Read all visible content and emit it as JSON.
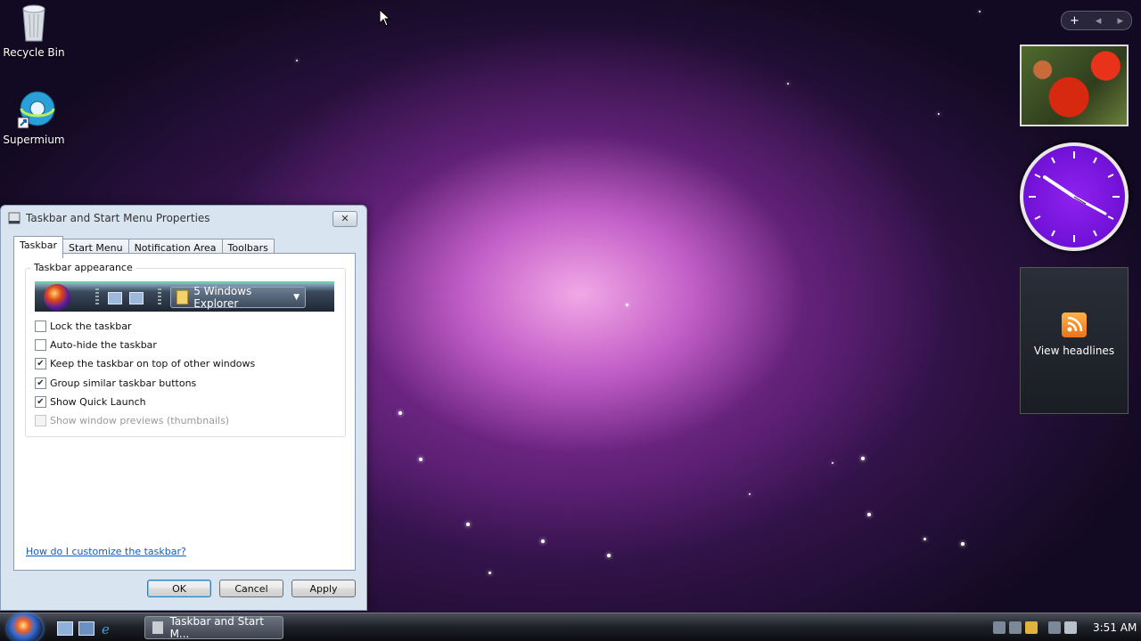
{
  "desktop": {
    "icons": [
      {
        "label": "Recycle Bin",
        "icon": "recycle-bin-icon"
      },
      {
        "label": "Supermium",
        "icon": "browser-globe-icon"
      }
    ]
  },
  "sidebar": {
    "controls": [
      "+",
      "◂",
      "▸"
    ],
    "feed_label": "View headlines",
    "clock_time": "3:51"
  },
  "dialog": {
    "title": "Taskbar and Start Menu Properties",
    "close_label": "✕",
    "tabs": [
      "Taskbar",
      "Start Menu",
      "Notification Area",
      "Toolbars"
    ],
    "active_tab": "Taskbar",
    "group_label": "Taskbar appearance",
    "preview_button_label": "5 Windows Explorer",
    "options": [
      {
        "label": "Lock the taskbar",
        "checked": false,
        "enabled": true
      },
      {
        "label": "Auto-hide the taskbar",
        "checked": false,
        "enabled": true
      },
      {
        "label": "Keep the taskbar on top of other windows",
        "checked": true,
        "enabled": true
      },
      {
        "label": "Group similar taskbar buttons",
        "checked": true,
        "enabled": true
      },
      {
        "label": "Show Quick Launch",
        "checked": true,
        "enabled": true
      },
      {
        "label": "Show window previews (thumbnails)",
        "checked": false,
        "enabled": false
      }
    ],
    "help_link": "How do I customize the taskbar?",
    "buttons": {
      "ok": "OK",
      "cancel": "Cancel",
      "apply": "Apply"
    }
  },
  "taskbar": {
    "task_button_label": "Taskbar and Start M...",
    "time": "3:51 AM"
  },
  "colors": {
    "clock_face": "#7011d6",
    "link": "#0b5dc9"
  }
}
